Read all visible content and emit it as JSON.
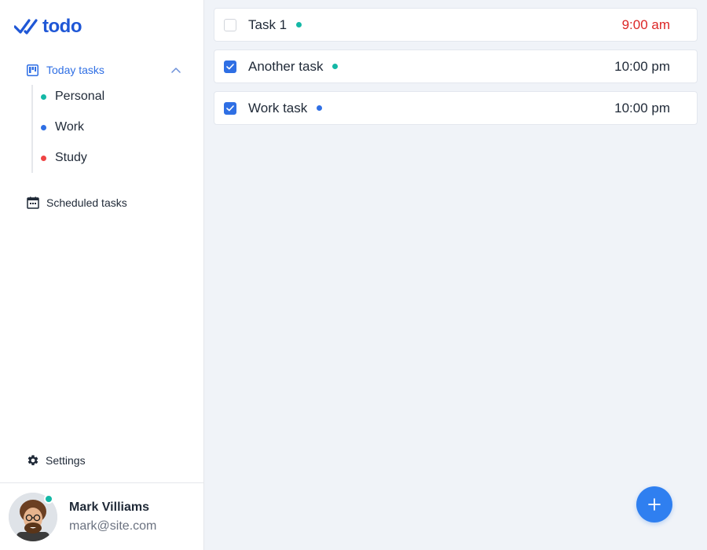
{
  "app": {
    "logo_text": "todo",
    "logo_icon": "double-check-icon",
    "brand_color": "#1f57d6"
  },
  "sidebar": {
    "today": {
      "label": "Today tasks",
      "icon": "board-icon",
      "expanded": true
    },
    "categories": [
      {
        "label": "Personal",
        "color": "#14b8a6"
      },
      {
        "label": "Work",
        "color": "#2f6fe4"
      },
      {
        "label": "Study",
        "color": "#ef4444"
      }
    ],
    "scheduled": {
      "label": "Scheduled tasks",
      "icon": "calendar-icon"
    },
    "settings": {
      "label": "Settings",
      "icon": "gear-icon"
    }
  },
  "profile": {
    "name": "Mark Villiams",
    "email": "mark@site.com",
    "status": "online",
    "status_color": "#14b8a6"
  },
  "tasks": [
    {
      "name": "Task 1",
      "done": false,
      "category_color": "#14b8a6",
      "time": "9:00 am",
      "time_color": "#dc2626"
    },
    {
      "name": "Another task",
      "done": true,
      "category_color": "#14b8a6",
      "time": "10:00 pm",
      "time_color": "#1f2937"
    },
    {
      "name": "Work task",
      "done": true,
      "category_color": "#2f6fe4",
      "time": "10:00 pm",
      "time_color": "#1f2937"
    }
  ],
  "fab": {
    "icon": "plus-icon",
    "color": "#2f7ff0"
  }
}
